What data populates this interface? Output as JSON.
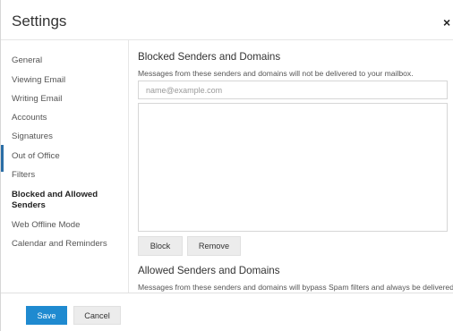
{
  "dialog": {
    "title": "Settings",
    "close_label": "×"
  },
  "sidebar": {
    "items": [
      {
        "label": "General",
        "active": false
      },
      {
        "label": "Viewing Email",
        "active": false
      },
      {
        "label": "Writing Email",
        "active": false
      },
      {
        "label": "Accounts",
        "active": false
      },
      {
        "label": "Signatures",
        "active": false
      },
      {
        "label": "Out of Office",
        "active": false
      },
      {
        "label": "Filters",
        "active": false
      },
      {
        "label": "Blocked and Allowed Senders",
        "active": true
      },
      {
        "label": "Web Offline Mode",
        "active": false
      },
      {
        "label": "Calendar and Reminders",
        "active": false
      }
    ],
    "accent_color": "#2b6ea6"
  },
  "blocked": {
    "title": "Blocked Senders and Domains",
    "description": "Messages from these senders and domains will not be delivered to your mailbox.",
    "input_value": "",
    "input_placeholder": "name@example.com",
    "entries": [],
    "block_label": "Block",
    "remove_label": "Remove"
  },
  "allowed": {
    "title": "Allowed Senders and Domains",
    "description": "Messages from these senders and domains will bypass Spam filters and always be delivered."
  },
  "footer": {
    "save_label": "Save",
    "cancel_label": "Cancel",
    "save_color": "#1f8ad0"
  }
}
